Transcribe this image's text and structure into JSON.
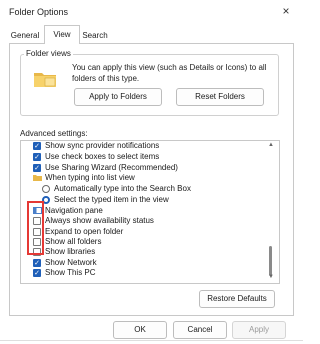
{
  "window": {
    "title": "Folder Options",
    "close_glyph": "×"
  },
  "tabs": [
    {
      "label": "General"
    },
    {
      "label": "View",
      "selected": true
    },
    {
      "label": "Search"
    }
  ],
  "folder_views": {
    "group_title": "Folder views",
    "description": "You can apply this view (such as Details or Icons) to all folders of this type.",
    "apply_button": "Apply to Folders",
    "reset_button": "Reset Folders",
    "icon": "folder-icon"
  },
  "advanced": {
    "label": "Advanced settings:",
    "items": [
      {
        "type": "checkbox",
        "checked": true,
        "text": "Show sync provider notifications"
      },
      {
        "type": "checkbox",
        "checked": true,
        "text": "Use check boxes to select items"
      },
      {
        "type": "checkbox",
        "checked": true,
        "text": "Use Sharing Wizard (Recommended)"
      },
      {
        "type": "category",
        "icon": "folder-icon",
        "text": "When typing into list view"
      },
      {
        "type": "radio",
        "checked": false,
        "text": "Automatically type into the Search Box"
      },
      {
        "type": "radio",
        "checked": true,
        "text": "Select the typed item in the view"
      },
      {
        "type": "category",
        "icon": "navigation-pane-icon",
        "text": "Navigation pane"
      },
      {
        "type": "checkbox",
        "checked": false,
        "text": "Always show availability status"
      },
      {
        "type": "checkbox",
        "checked": false,
        "text": "Expand to open folder"
      },
      {
        "type": "checkbox",
        "checked": false,
        "text": "Show all folders"
      },
      {
        "type": "checkbox",
        "checked": false,
        "text": "Show libraries"
      },
      {
        "type": "checkbox",
        "checked": true,
        "text": "Show Network"
      },
      {
        "type": "checkbox",
        "checked": true,
        "text": "Show This PC"
      }
    ]
  },
  "restore_button": "Restore Defaults",
  "footer": {
    "ok": "OK",
    "cancel": "Cancel",
    "apply": "Apply"
  },
  "colors": {
    "accent": "#1f5fb8",
    "highlight": "#e53935"
  }
}
